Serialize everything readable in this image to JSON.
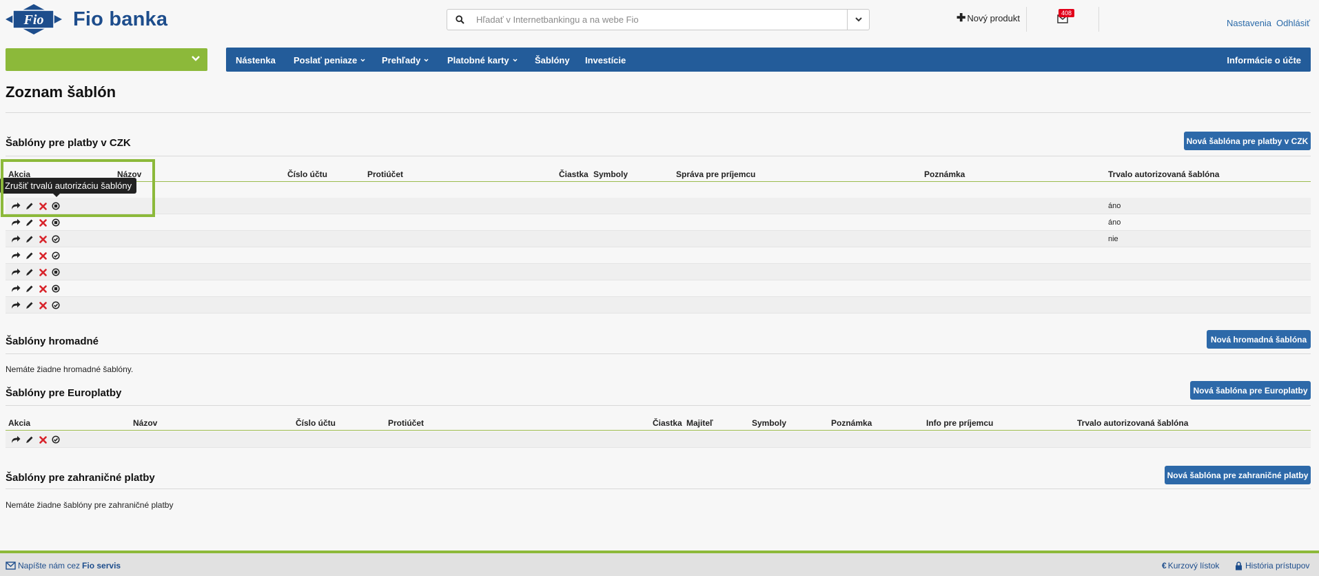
{
  "brand": {
    "logo_mark": "Fio",
    "name": "Fio banka"
  },
  "search": {
    "placeholder": "Hľadať v Internetbankingu a na webe Fio"
  },
  "header": {
    "new_product": "Nový produkt",
    "mail_badge": "408",
    "settings": "Nastavenia",
    "logout": "Odhlásiť"
  },
  "nav": {
    "items": [
      {
        "label": "Nástenka",
        "has_dropdown": false
      },
      {
        "label": "Poslať peniaze",
        "has_dropdown": true
      },
      {
        "label": "Prehľady",
        "has_dropdown": true
      },
      {
        "label": "Platobné karty",
        "has_dropdown": true
      },
      {
        "label": "Šablóny",
        "has_dropdown": false
      },
      {
        "label": "Investície",
        "has_dropdown": false
      }
    ],
    "account_info": "Informácie o účte"
  },
  "page": {
    "title": "Zoznam šablón"
  },
  "czk": {
    "title": "Šablóny pre platby v CZK",
    "new_button": "Nová šablóna pre platby v CZK",
    "columns": [
      "Akcia",
      "Názov",
      "Číslo účtu",
      "Protiúčet",
      "Čiastka",
      "Symboly",
      "Správa pre príjemcu",
      "Poznámka",
      "Trvalo autorizovaná šablóna"
    ],
    "tooltip": "Zrušiť trvalú autorizáciu šablóny",
    "rows": [
      {
        "auth_icon": "cancel-authorization-icon",
        "trvalo": "áno"
      },
      {
        "auth_icon": "cancel-authorization-icon",
        "trvalo": "áno"
      },
      {
        "auth_icon": "authorize-icon",
        "trvalo": "nie"
      },
      {
        "auth_icon": "authorize-icon",
        "trvalo": ""
      },
      {
        "auth_icon": "cancel-authorization-icon",
        "trvalo": ""
      },
      {
        "auth_icon": "cancel-authorization-icon",
        "trvalo": ""
      },
      {
        "auth_icon": "authorize-icon",
        "trvalo": ""
      }
    ]
  },
  "bulk": {
    "title": "Šablóny hromadné",
    "new_button": "Nová hromadná šablóna",
    "empty": "Nemáte žiadne hromadné šablóny."
  },
  "euro": {
    "title": "Šablóny pre Europlatby",
    "new_button": "Nová šablóna pre Europlatby",
    "columns": [
      "Akcia",
      "Názov",
      "Číslo účtu",
      "Protiúčet",
      "Čiastka",
      "Majiteľ",
      "Symboly",
      "Poznámka",
      "Info pre príjemcu",
      "Trvalo autorizovaná šablóna"
    ],
    "rows": [
      {
        "auth_icon": "authorize-icon",
        "trvalo": ""
      }
    ]
  },
  "foreign": {
    "title": "Šablóny pre zahraničné platby",
    "new_button": "Nová šablóna pre zahraničné platby",
    "empty": "Nemáte žiadne šablóny pre zahraničné platby"
  },
  "footer": {
    "write_prefix": "Napíšte nám cez",
    "write_service": "Fio servis",
    "rates": "Kurzový lístok",
    "history": "História prístupov"
  },
  "colors": {
    "brand_blue": "#235c9a",
    "accent_green": "#8cb93a",
    "button_blue": "#2d69a9",
    "badge_red": "#e2001a"
  }
}
